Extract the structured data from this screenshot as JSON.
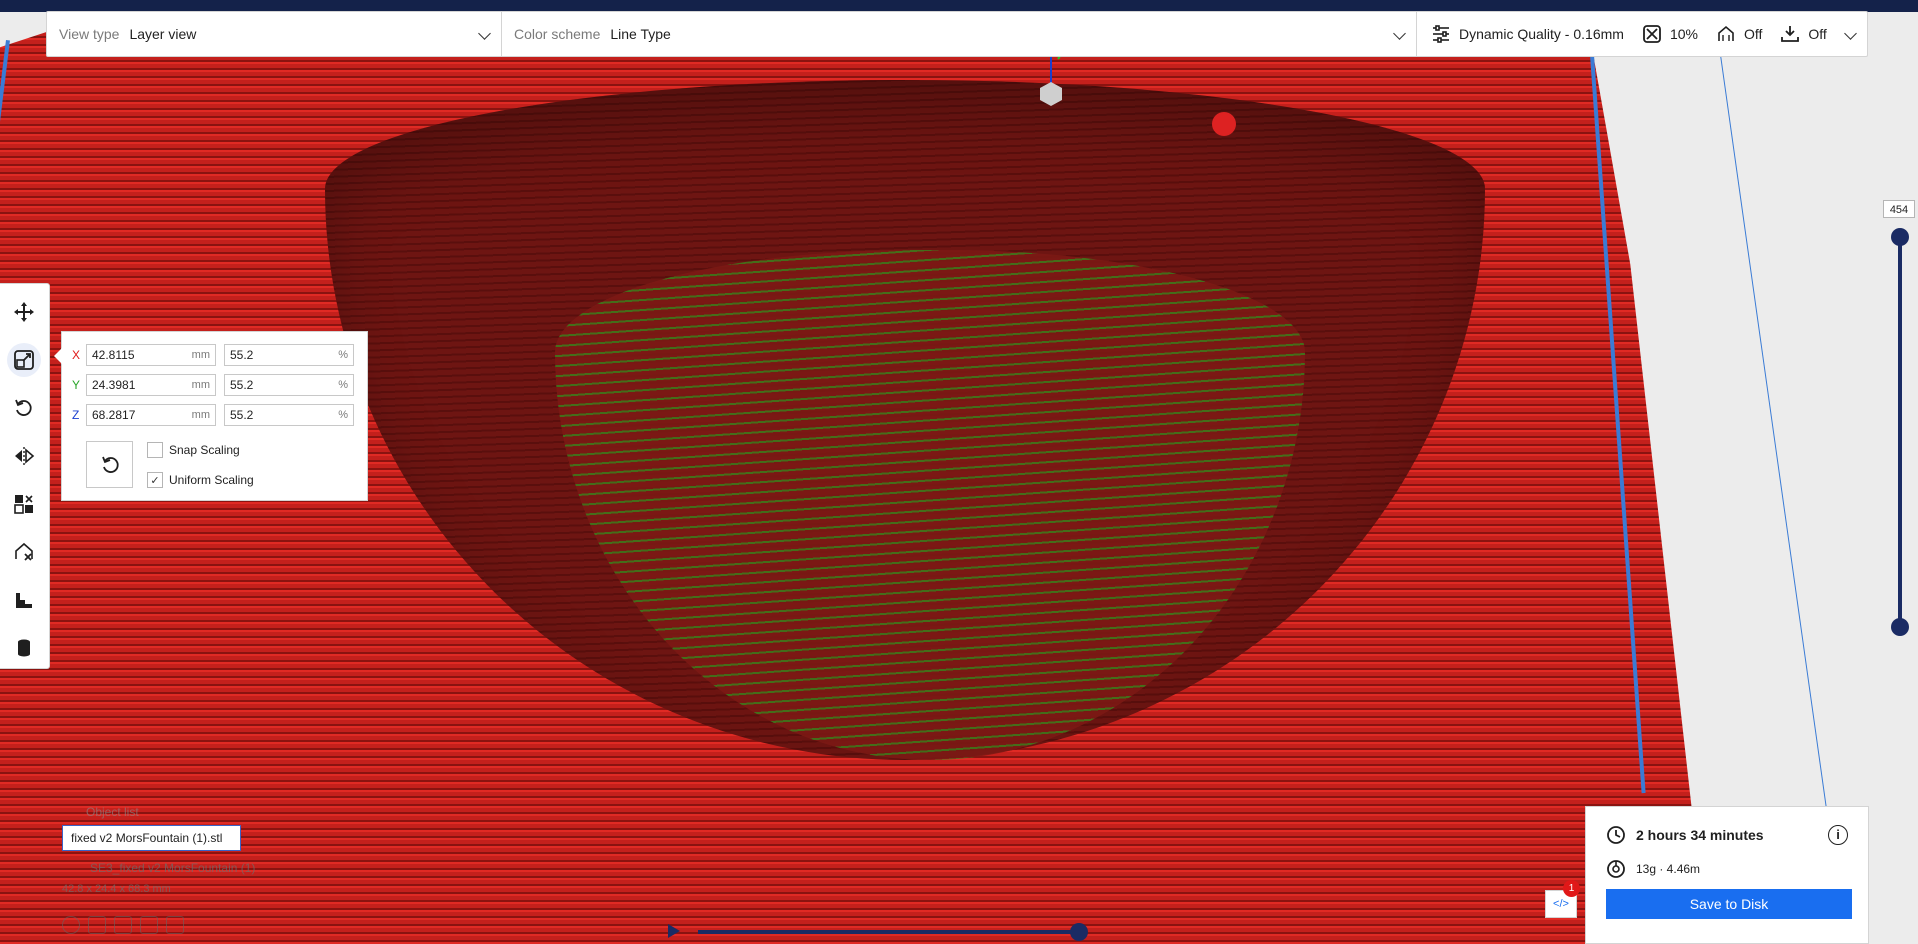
{
  "header": {
    "view_type_label": "View type",
    "view_type_value": "Layer view",
    "color_scheme_label": "Color scheme",
    "color_scheme_value": "Line Type",
    "profile": "Dynamic Quality - 0.16mm",
    "infill": "10%",
    "support": "Off",
    "adhesion": "Off"
  },
  "toolbar": {
    "tools": [
      "move-tool",
      "scale-tool",
      "rotate-tool",
      "mirror-tool",
      "per-model-settings-tool",
      "support-blocker-tool",
      "custom-supports-tool",
      "cylinder-tool"
    ],
    "active": "scale-tool"
  },
  "scale_panel": {
    "x_label": "X",
    "x_mm": "42.8115",
    "x_pct": "55.2",
    "y_label": "Y",
    "y_mm": "24.3981",
    "y_pct": "55.2",
    "z_label": "Z",
    "z_mm": "68.2817",
    "z_pct": "55.2",
    "unit_mm": "mm",
    "unit_pct": "%",
    "snap_scaling": "Snap Scaling",
    "uniform_scaling": "Uniform Scaling",
    "uniform_checked": true
  },
  "layer_slider": {
    "value": "454"
  },
  "object_list": {
    "header": "Object list",
    "file": "fixed v2 MorsFountain (1).stl",
    "job_name": "SE3_fixed v2 MorsFountain (1)",
    "dimensions": "42.8 x 24.4 x 68.3 mm"
  },
  "output": {
    "time": "2 hours 34 minutes",
    "material": "13g · 4.46m",
    "save_label": "Save to Disk",
    "plugin_badge": "1"
  },
  "colors": {
    "accent": "#196ef0",
    "dark_navy": "#1a2b64",
    "wall_red": "#c4201c",
    "infill_green": "#3e7d1c",
    "x_axis": "#e01818",
    "y_axis": "#2aa52a",
    "z_axis": "#1a3fd0"
  }
}
